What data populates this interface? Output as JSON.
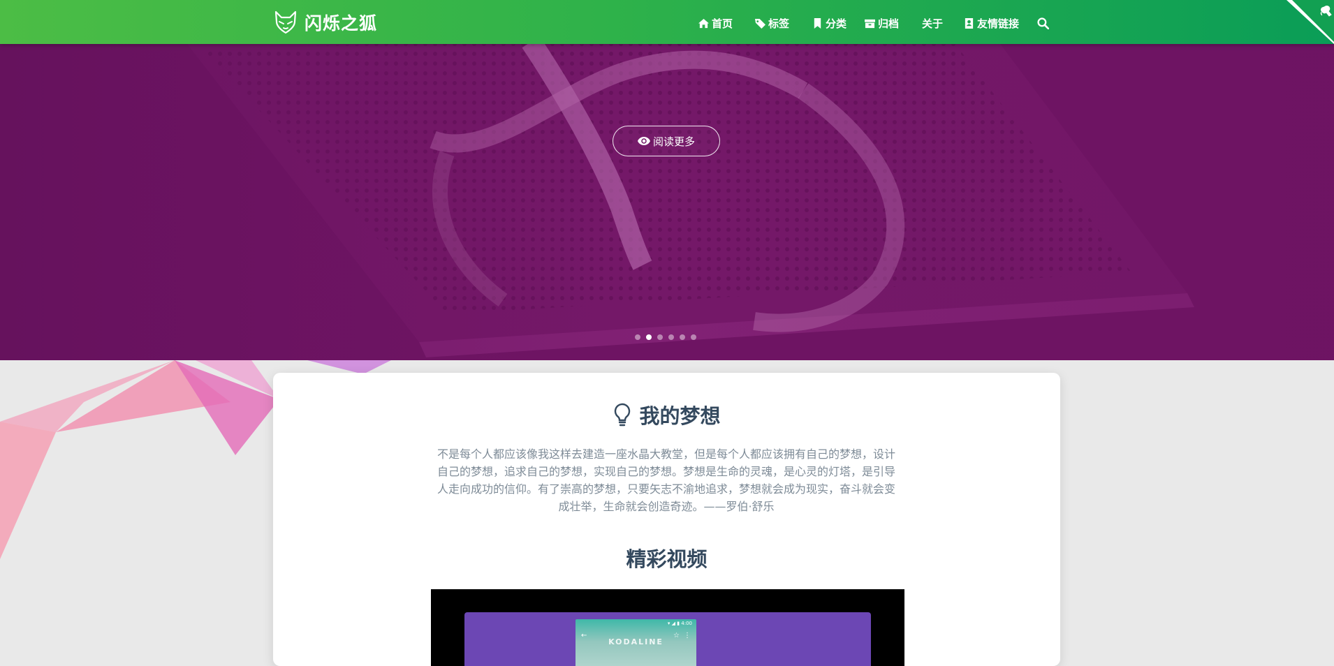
{
  "site": {
    "brand_title": "闪烁之狐"
  },
  "nav": {
    "items": [
      {
        "label": "首页",
        "icon": "home-icon"
      },
      {
        "label": "标签",
        "icon": "tags-icon"
      },
      {
        "label": "分类",
        "icon": "bookmark-icon"
      },
      {
        "label": "归档",
        "icon": "archive-icon"
      },
      {
        "label": "关于",
        "icon": ""
      },
      {
        "label": "友情链接",
        "icon": "address-card-icon"
      }
    ],
    "search_icon": "search-icon"
  },
  "hero": {
    "subtitle": "",
    "read_more_label": "阅读更多",
    "slides": 6,
    "active_slide": 2,
    "overlay_color": "#6e1463"
  },
  "dream": {
    "title": "我的梦想",
    "text": "不是每个人都应该像我这样去建造一座水晶大教堂，但是每个人都应该拥有自己的梦想，设计自己的梦想，追求自己的梦想，实现自己的梦想。梦想是生命的灵魂，是心灵的灯塔，是引导人走向成功的信仰。有了崇高的梦想，只要矢志不渝地追求，梦想就会成为现实，奋斗就会变成壮举，生命就会创造奇迹。——罗伯·舒乐"
  },
  "video": {
    "title": "精彩视频",
    "phone_brand": "KODALINE"
  },
  "colors": {
    "nav_start": "#4cbd45",
    "nav_end": "#0a9d57",
    "heading": "#34495e",
    "body_text": "#7e8b97",
    "hero_overlay": "#6e1463"
  }
}
